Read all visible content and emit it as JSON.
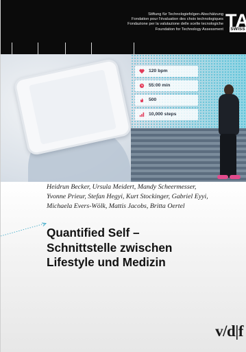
{
  "header": {
    "org_lines": [
      "Stiftung für Technologiefolgen-Abschätzung",
      "Fondation pour l'évaluation des choix technologiques",
      "Fondazione per la valutazione delle scelte tecnologiche",
      "Foundation for Technology Assessment"
    ],
    "logo": {
      "letters": "TA",
      "badge": "SWISS"
    }
  },
  "photo": {
    "stats": [
      {
        "icon": "heart-icon",
        "text": "120 bpm"
      },
      {
        "icon": "clock-icon",
        "text": "55:00 min"
      },
      {
        "icon": "flame-icon",
        "text": "500"
      },
      {
        "icon": "steps-icon",
        "text": "10,000 steps"
      }
    ],
    "accent_color": "#e23b5a"
  },
  "authors": [
    "Heidrun Becker, Ursula Meidert, Mandy Scheermesser,",
    "Yvonne Prieur, Stefan Hegyi, Kurt Stockinger, Gabriel Eyyi,",
    "Michaela Evers-Wölk, Mattis Jacobs, Britta Oertel"
  ],
  "title_lines": [
    "Quantified Self –",
    "Schnittstelle zwischen",
    "Lifestyle und Medizin"
  ],
  "publisher": "v/d|f"
}
